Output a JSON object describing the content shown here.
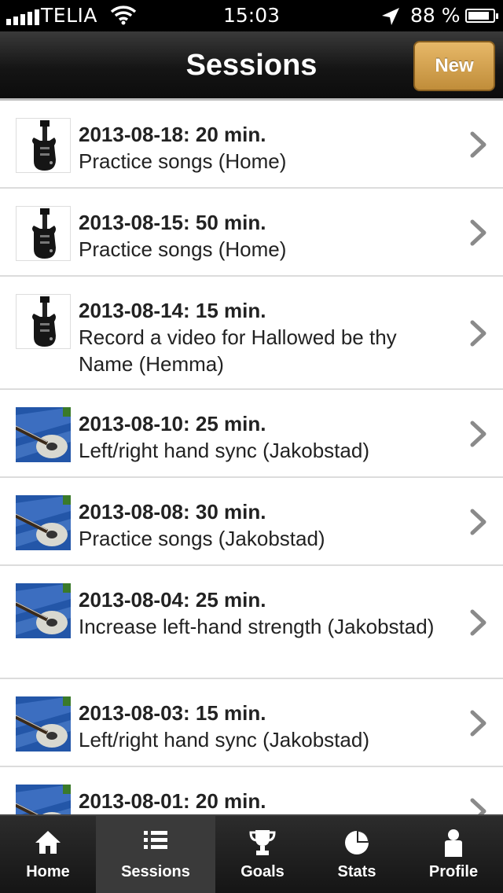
{
  "status_bar": {
    "carrier": "TELIA",
    "time": "15:03",
    "battery": "88 %",
    "battery_level": 0.88
  },
  "nav": {
    "title": "Sessions",
    "new_label": "New"
  },
  "sessions": [
    {
      "title": "2013-08-18: 20 min.",
      "subtitle": "Practice songs (Home)",
      "thumb": "electric-guitar"
    },
    {
      "title": "2013-08-15: 50 min.",
      "subtitle": "Practice songs (Home)",
      "thumb": "electric-guitar"
    },
    {
      "title": "2013-08-14: 15 min.",
      "subtitle": "Record a video for Hallowed be thy Name (Hemma)",
      "thumb": "electric-guitar"
    },
    {
      "title": "2013-08-10: 25 min.",
      "subtitle": "Left/right hand sync (Jakobstad)",
      "thumb": "acoustic-guitar"
    },
    {
      "title": "2013-08-08: 30 min.",
      "subtitle": "Practice songs (Jakobstad)",
      "thumb": "acoustic-guitar"
    },
    {
      "title": "2013-08-04: 25 min.",
      "subtitle": "Increase left-hand strength (Jakobstad)",
      "thumb": "acoustic-guitar"
    },
    {
      "title": "2013-08-03: 15 min.",
      "subtitle": "Left/right hand sync (Jakobstad)",
      "thumb": "acoustic-guitar"
    },
    {
      "title": "2013-08-01: 20 min.",
      "subtitle": "",
      "thumb": "acoustic-guitar"
    }
  ],
  "tabs": [
    {
      "label": "Home",
      "icon": "home-icon"
    },
    {
      "label": "Sessions",
      "icon": "list-icon",
      "active": true
    },
    {
      "label": "Goals",
      "icon": "trophy-icon"
    },
    {
      "label": "Stats",
      "icon": "pie-chart-icon"
    },
    {
      "label": "Profile",
      "icon": "person-icon"
    }
  ]
}
